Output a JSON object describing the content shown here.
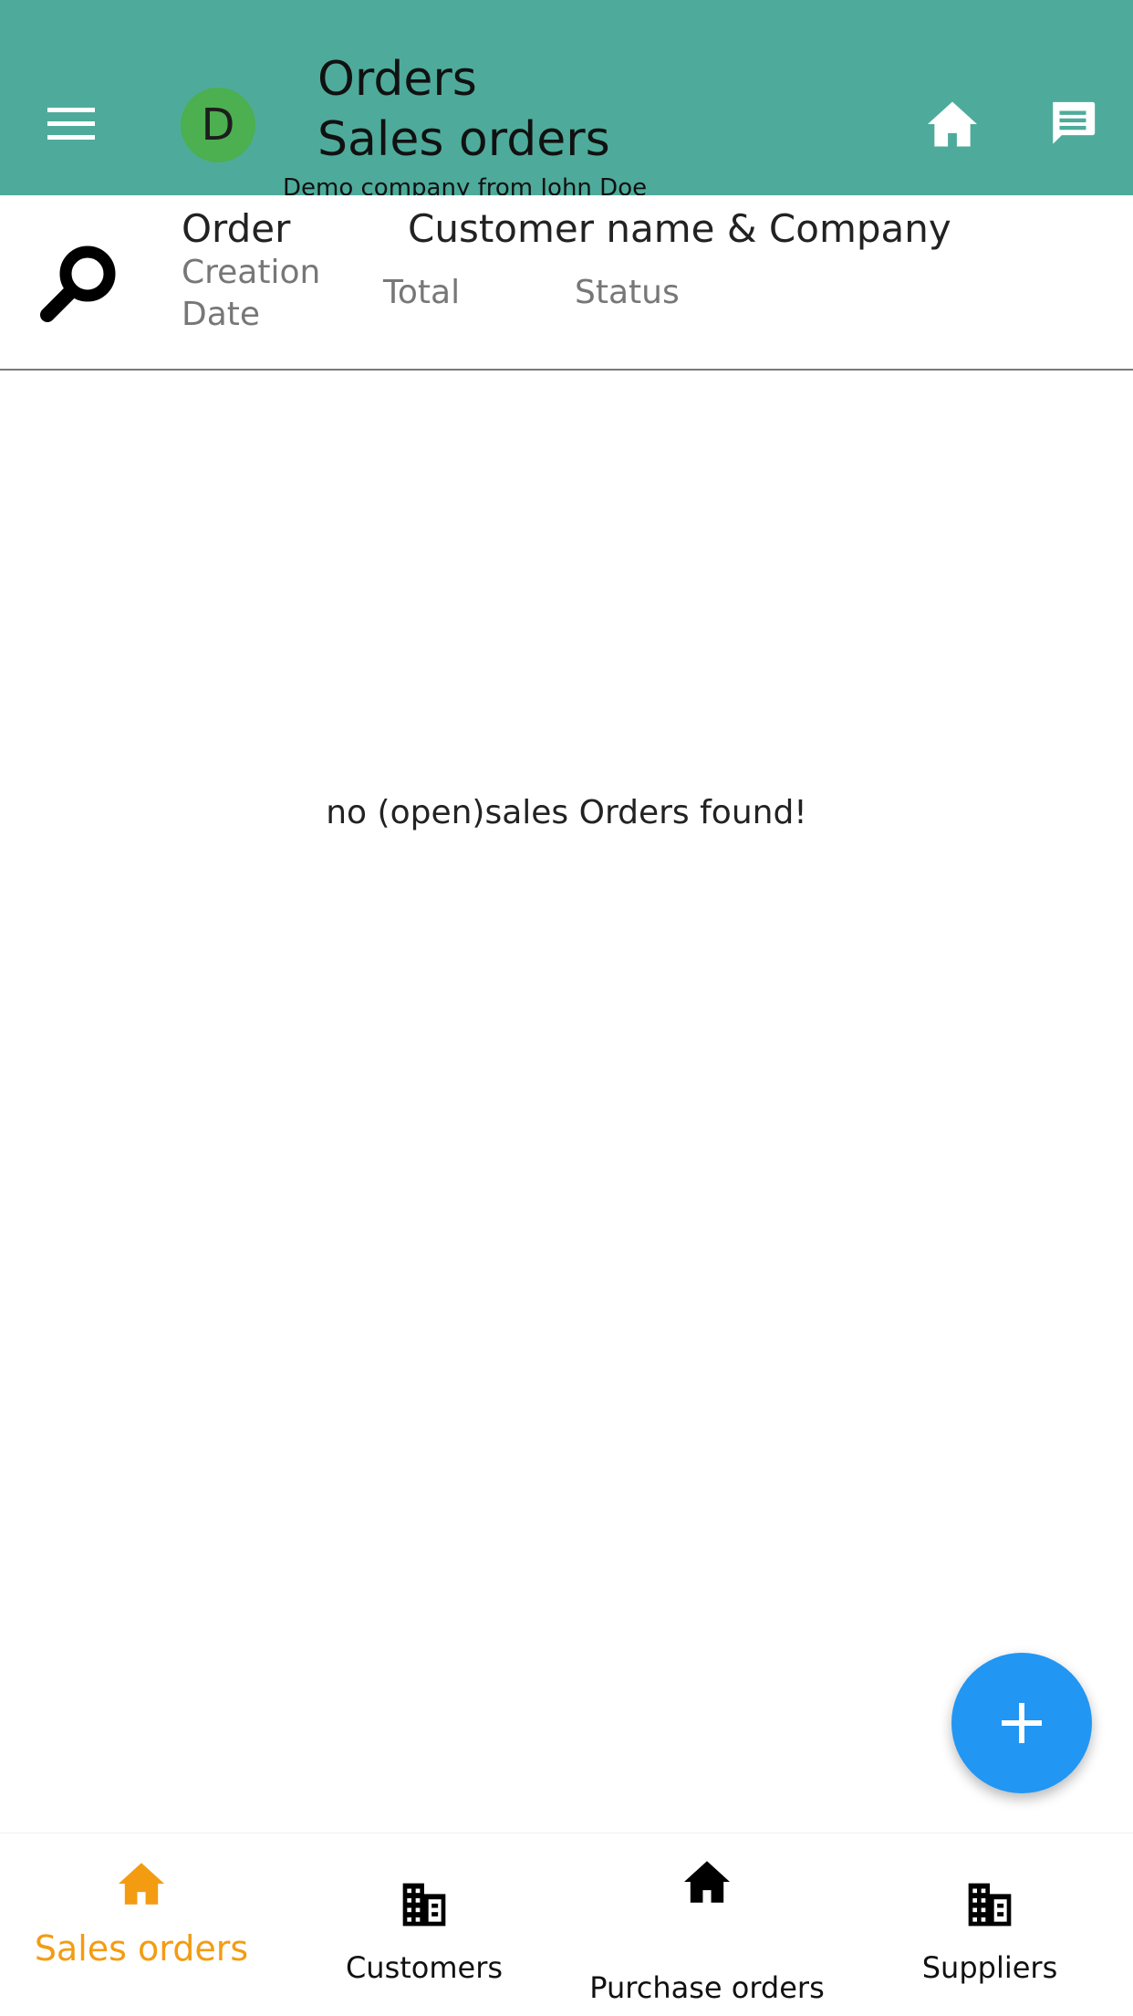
{
  "appbar": {
    "avatar_letter": "D",
    "title_line1": "Orders",
    "title_line2": "Sales orders",
    "company": "Demo company from John Doe",
    "background_color": "#4eab9b",
    "icons": {
      "menu": "menu-icon",
      "home": "home-icon",
      "chat": "chat-icon"
    }
  },
  "list_header": {
    "search_icon": "search-icon",
    "col_order": "Order",
    "col_customer": "Customer name & Company",
    "col_date": "Creation Date",
    "col_total": "Total",
    "col_status": "Status"
  },
  "main": {
    "empty_message": "no (open)sales Orders found!"
  },
  "fab": {
    "icon": "plus-icon",
    "color": "#2196f3"
  },
  "bottom_nav": {
    "active_color": "#f39c12",
    "items": [
      {
        "label": "Sales orders",
        "icon": "home-icon",
        "active": true
      },
      {
        "label": "Customers",
        "icon": "building-icon",
        "active": false
      },
      {
        "label": "Purchase orders",
        "icon": "home-icon",
        "active": false
      },
      {
        "label": "Suppliers",
        "icon": "building-icon",
        "active": false
      }
    ]
  }
}
